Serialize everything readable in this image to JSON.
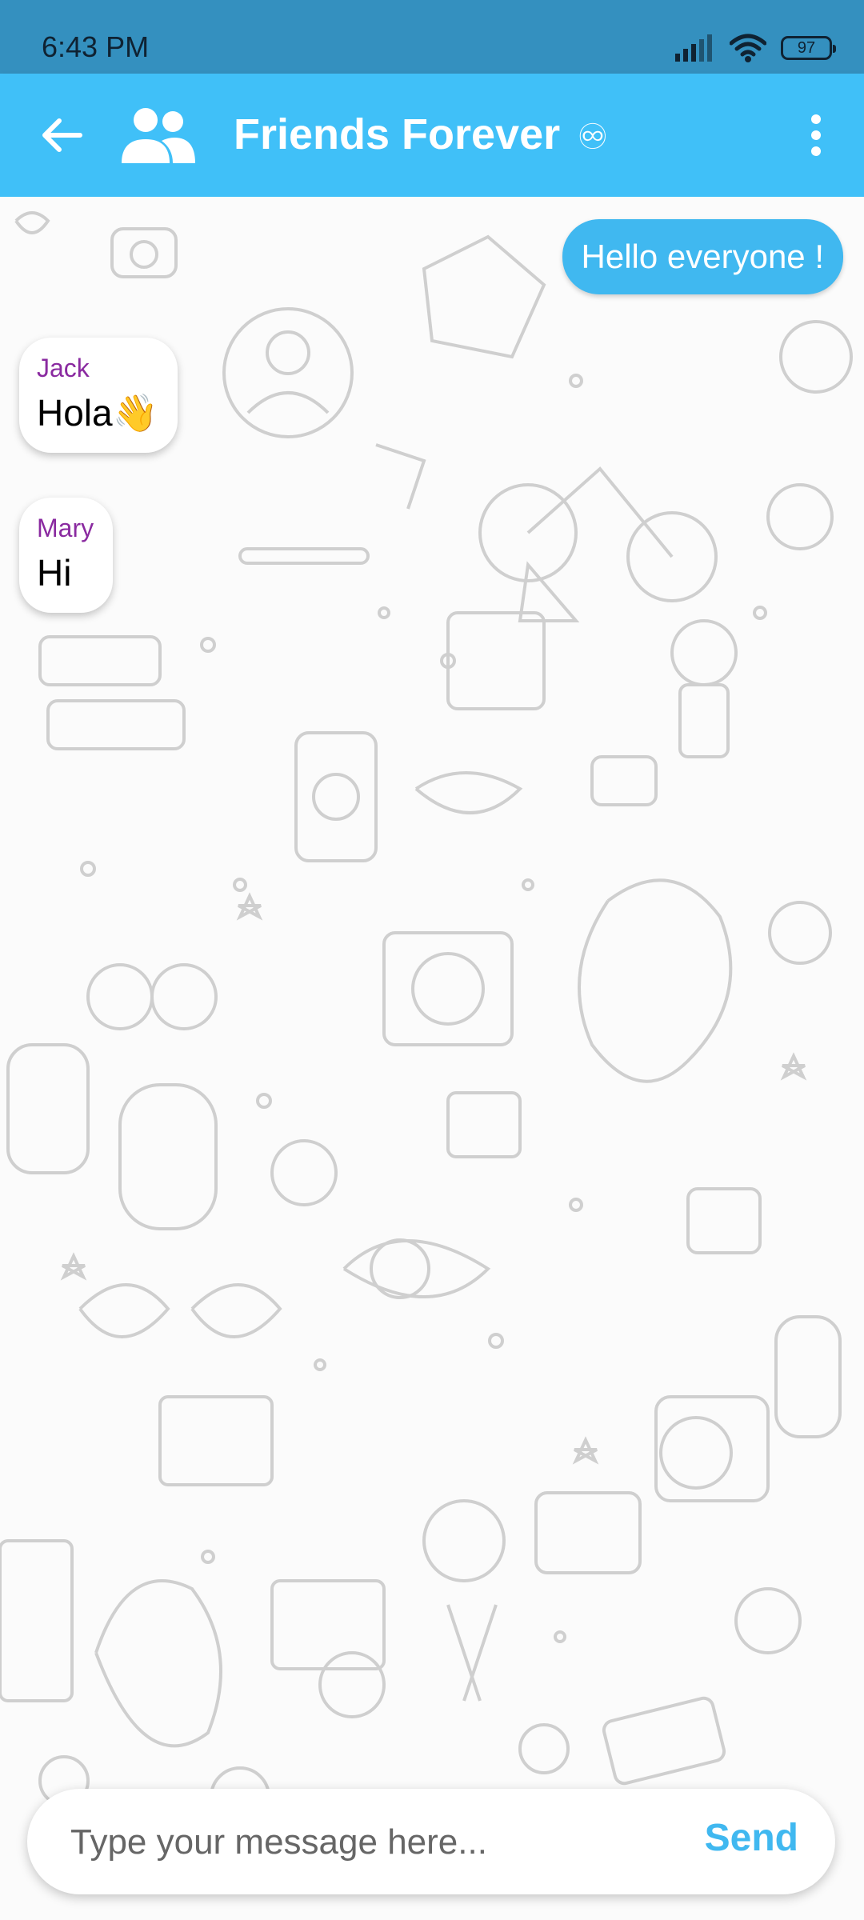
{
  "status_bar": {
    "time": "6:43 PM",
    "battery": "97",
    "icons": [
      "signal-icon",
      "wifi-icon",
      "battery-icon"
    ]
  },
  "app_bar": {
    "title": "Friends Forever",
    "title_suffix": "♾",
    "icons": [
      "back-arrow-icon",
      "group-icon",
      "more-vert-icon"
    ],
    "color": "#40c0f8"
  },
  "messages": [
    {
      "direction": "outgoing",
      "text": "Hello everyone !"
    },
    {
      "direction": "incoming",
      "sender": "Jack",
      "text": "Hola👋"
    },
    {
      "direction": "incoming",
      "sender": "Mary",
      "text": "Hi"
    }
  ],
  "composer": {
    "placeholder": "Type your message here...",
    "value": "",
    "send_label": "Send"
  },
  "colors": {
    "status_bar": "#3490bf",
    "accent": "#40c0f8",
    "sender_name": "#8a2aa0"
  }
}
